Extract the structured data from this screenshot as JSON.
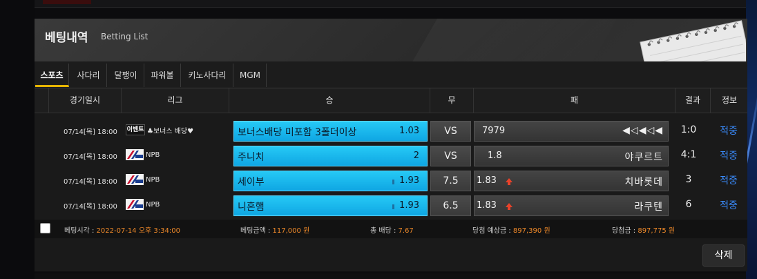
{
  "header": {
    "title_ko": "베팅내역",
    "title_en": "Betting List"
  },
  "tabs": [
    {
      "label": "스포츠",
      "active": true
    },
    {
      "label": "사다리",
      "active": false
    },
    {
      "label": "달팽이",
      "active": false
    },
    {
      "label": "파워볼",
      "active": false
    },
    {
      "label": "키노사다리",
      "active": false
    },
    {
      "label": "MGM",
      "active": false
    }
  ],
  "columns": {
    "date": "경기일시",
    "league": "리그",
    "win": "승",
    "draw": "무",
    "lose": "패",
    "result": "결과",
    "info": "정보"
  },
  "rows": [
    {
      "date": "07/14[목] 18:00",
      "league_logo": "이벤트",
      "league": "♣보너스 배당♥",
      "win_name": "보너스배당 미포함 3폴더이상",
      "win_odds": "1.03",
      "draw": "VS",
      "lose_odds": "7979",
      "lose_name": "◀◁◀◁◀",
      "result": "1:0",
      "info": "적중"
    },
    {
      "date": "07/14[목] 18:00",
      "league_logo": "npb-logo",
      "league": "NPB",
      "win_name": "주니치",
      "win_odds": "2",
      "draw": "VS",
      "lose_odds": "1.8",
      "lose_name": "야쿠르트",
      "result": "4:1",
      "info": "적중"
    },
    {
      "date": "07/14[목] 18:00",
      "league_logo": "npb-logo",
      "league": "NPB",
      "win_name": "세이부",
      "win_odds": "1.93",
      "draw": "7.5",
      "lose_odds": "1.83",
      "lose_name": "치바롯데",
      "result": "3",
      "info": "적중"
    },
    {
      "date": "07/14[목] 18:00",
      "league_logo": "npb-logo",
      "league": "NPB",
      "win_name": "니혼햄",
      "win_odds": "1.93",
      "draw": "6.5",
      "lose_odds": "1.83",
      "lose_name": "라쿠텐",
      "result": "6",
      "info": "적중"
    }
  ],
  "summary": {
    "bet_time_label": "베팅시각 : ",
    "bet_time": "2022-07-14 오후 3:34:00",
    "bet_amount_label": "베팅금액 : ",
    "bet_amount": "117,000 원",
    "total_odds_label": "총 배당 : ",
    "total_odds": "7.67",
    "expected_label": "당첨 예상금 : ",
    "expected": "897,390 원",
    "prize_label": "당첨금 : ",
    "prize": "897,775 원"
  },
  "actions": {
    "delete_label": "삭제"
  },
  "colors": {
    "win_blue": "#0fa6e3",
    "accent_orange": "#f08a2a",
    "link_blue": "#3a8cff",
    "tab_underline": "#e5b400",
    "arrow_red": "#e8422a"
  },
  "icons": [
    "npb-logo",
    "up-arrow-icon",
    "notepad-decoration"
  ]
}
